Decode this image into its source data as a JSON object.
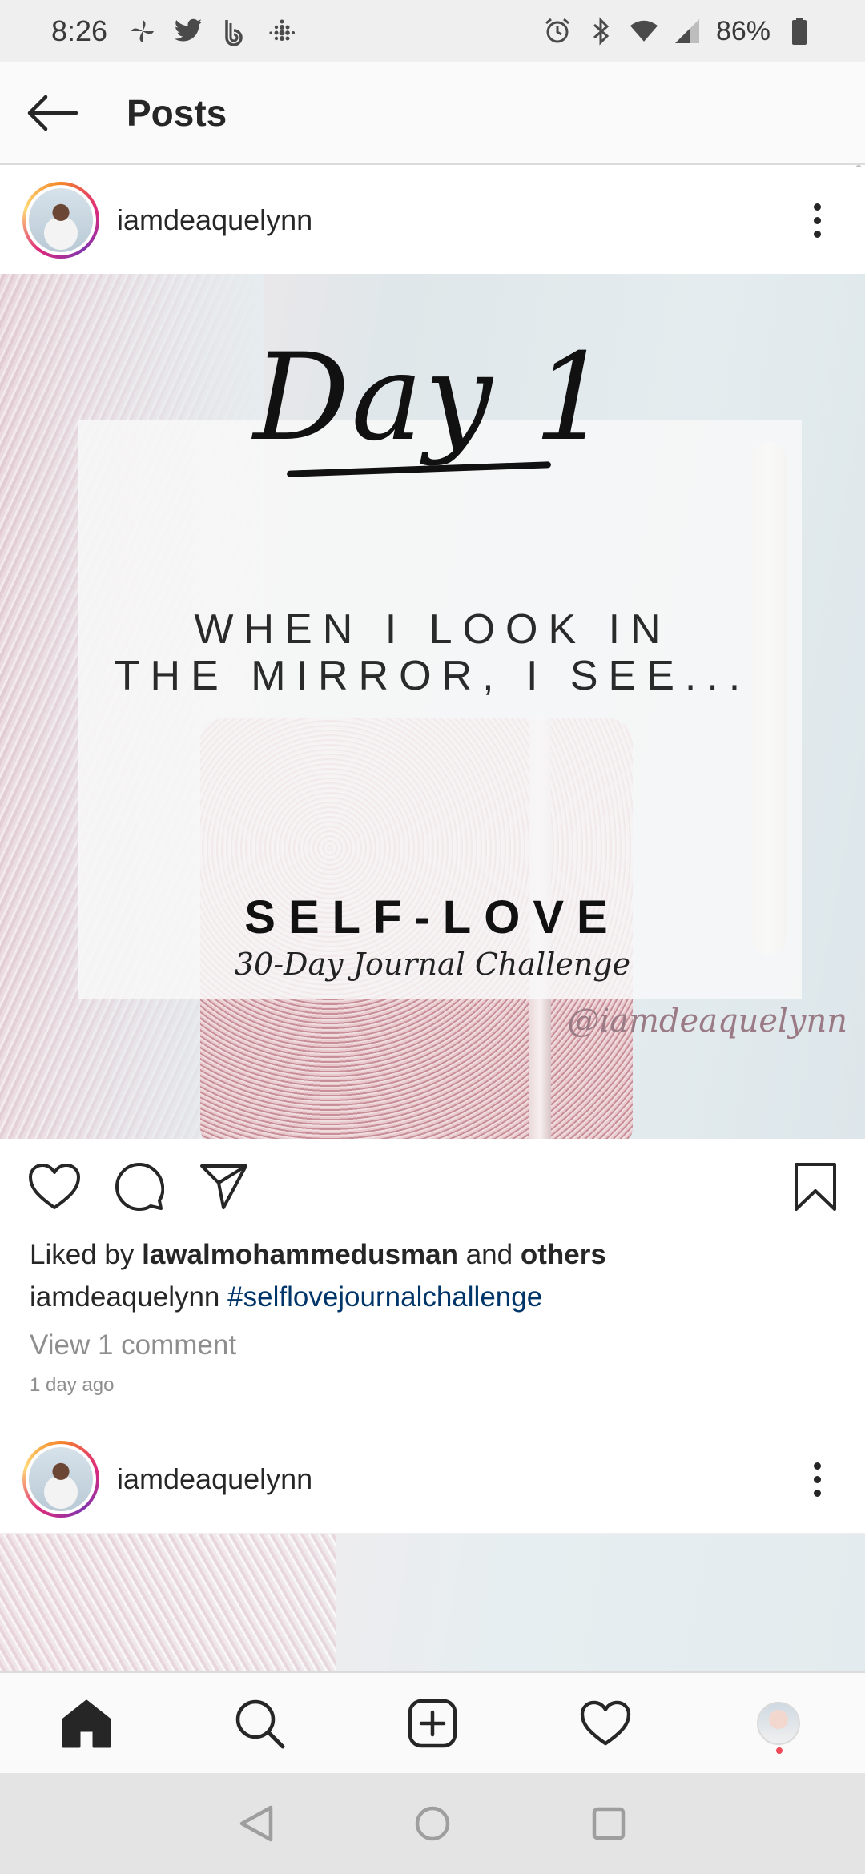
{
  "status_bar": {
    "time": "8:26",
    "battery": "86%",
    "left_icons": [
      "pinwheel-icon",
      "twitter-icon",
      "b-app-icon",
      "fitbit-icon"
    ],
    "right_icons": [
      "alarm-icon",
      "bluetooth-icon",
      "wifi-icon",
      "signal-icon",
      "battery-icon"
    ]
  },
  "app_bar": {
    "title": "Posts",
    "back_icon": "arrow-left-icon"
  },
  "posts": [
    {
      "username": "iamdeaquelynn",
      "image": {
        "day_text": "Day 1",
        "mirror_line1": "WHEN I LOOK IN",
        "mirror_line2": "THE MIRROR, I SEE...",
        "title": "SELF-LOVE",
        "subtitle": "30-Day Journal Challenge",
        "watermark": "@iamdeaquelynn"
      },
      "liked_by_prefix": "Liked by",
      "liked_by_user": "lawalmohammedusman",
      "liked_by_and": "and",
      "liked_by_others": "others",
      "caption_user": "iamdeaquelynn",
      "caption_hashtag": "#selflovejournalchallenge",
      "view_comments": "View 1 comment",
      "time_ago": "1 day ago"
    },
    {
      "username": "iamdeaquelynn"
    }
  ],
  "bottom_nav": {
    "items": [
      "home-icon",
      "search-icon",
      "new-post-icon",
      "activity-heart-icon",
      "profile-avatar"
    ]
  },
  "system_nav": {
    "items": [
      "back-triangle-icon",
      "home-circle-icon",
      "recents-square-icon"
    ]
  },
  "colors": {
    "hashtag": "#003569",
    "muted": "#8e8e8e",
    "notification": "#ed4956"
  }
}
